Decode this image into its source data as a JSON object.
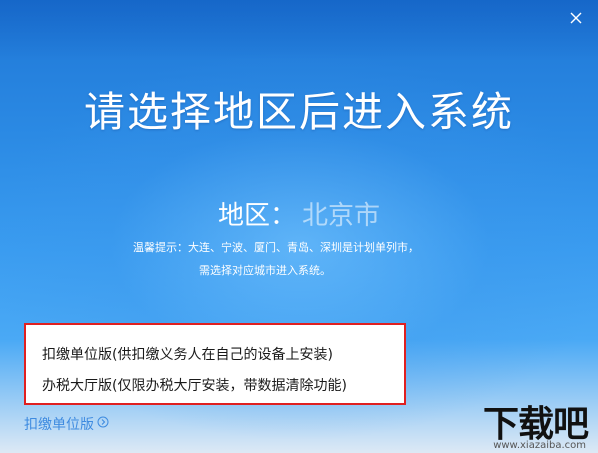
{
  "window": {
    "close_icon": "close-icon"
  },
  "header": {
    "title": "请选择地区后进入系统"
  },
  "region": {
    "label": "地区：",
    "value": "北京市"
  },
  "tip": {
    "line1": "温馨提示：大连、宁波、厦门、青岛、深圳是计划单列市，",
    "line2": "需选择对应城市进入系统。"
  },
  "versions": {
    "options": [
      "扣缴单位版(供扣缴义务人在自己的设备上安装)",
      "办税大厅版(仅限办税大厅安装，带数据清除功能)"
    ],
    "current": "扣缴单位版",
    "highlight_color": "#e02020"
  },
  "watermark": {
    "text": "下载吧",
    "url": "www.xiazaiba.com"
  },
  "colors": {
    "accent": "#3e8be0",
    "background_top": "#1f77d6",
    "background_bottom": "#dde9f5"
  }
}
